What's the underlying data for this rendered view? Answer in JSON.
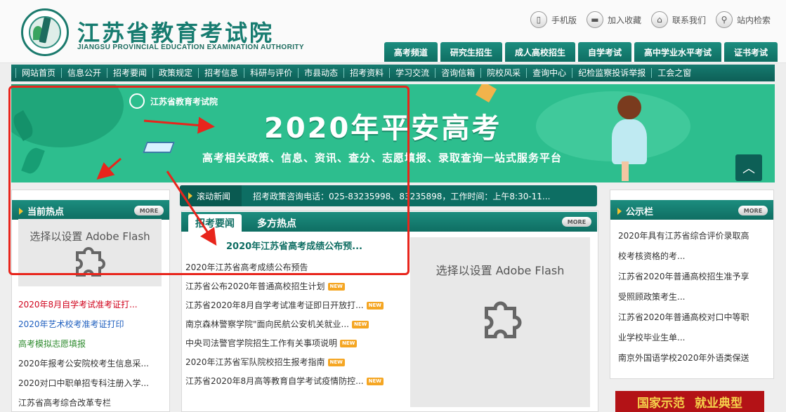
{
  "header": {
    "title": "江苏省教育考试院",
    "subtitle": "JIANGSU PROVINCIAL EDUCATION EXAMINATION AUTHORITY",
    "top_links": [
      {
        "label": "手机版",
        "icon": "phone-icon"
      },
      {
        "label": "加入收藏",
        "icon": "folder-icon"
      },
      {
        "label": "联系我们",
        "icon": "home-icon"
      },
      {
        "label": "站内检索",
        "icon": "search-icon"
      }
    ],
    "tabs": [
      "高考频道",
      "研究生招生",
      "成人高校招生",
      "自学考试",
      "高中学业水平考试",
      "证书考试"
    ]
  },
  "nav": [
    "网站首页",
    "信息公开",
    "招考要闻",
    "政策规定",
    "招考信息",
    "科研与评价",
    "市县动态",
    "招考资料",
    "学习交流",
    "咨询信箱",
    "院校风采",
    "查询中心",
    "纪检监察投诉举报",
    "工会之窗"
  ],
  "banner": {
    "logo_text": "江苏省教育考试院",
    "title": "2020年平安高考",
    "slogan": "高考相关政策、信息、资讯、查分、志愿填报、录取查询一站式服务平台"
  },
  "left_panel": {
    "title": "当前热点",
    "more": "MORE",
    "flash_text": "选择以设置 Adobe Flash",
    "items": [
      {
        "text": "2020年8月自学考试准考证打...",
        "color": "#d0021b"
      },
      {
        "text": "2020年艺术校考准考证打印",
        "color": "#1f5fbf"
      },
      {
        "text": "高考模拟志愿填报",
        "color": "#2e8b2e"
      },
      {
        "text": "2020年报考公安院校考生信息采...",
        "color": "#333333"
      },
      {
        "text": "2020对口中职单招专科注册入学...",
        "color": "#333333"
      },
      {
        "text": "江苏省高考综合改革专栏",
        "color": "#333333"
      }
    ]
  },
  "scroll_news": {
    "label": "滚动新闻",
    "text": "招考政策咨询电话：025-83235998、83235898，工作时间：上午8:30-11..."
  },
  "middle": {
    "tab_active": "招考要闻",
    "tab_other": "多方热点",
    "more": "MORE",
    "headline": "2020年江苏省高考成绩公布预...",
    "items": [
      {
        "text": "2020年江苏省高考成绩公布预告",
        "new": false
      },
      {
        "text": "江苏省公布2020年普通高校招生计划",
        "new": true
      },
      {
        "text": "江苏省2020年8月自学考试准考证即日开放打...",
        "new": true
      },
      {
        "text": "南京森林警察学院\"面向民航公安机关就业...",
        "new": true
      },
      {
        "text": "中央司法警官学院招生工作有关事项说明",
        "new": true
      },
      {
        "text": "2020年江苏省军队院校招生报考指南",
        "new": true
      },
      {
        "text": "江苏省2020年8月高等教育自学考试疫情防控...",
        "new": true
      }
    ],
    "new_label": "NEW",
    "flash_text": "选择以设置 Adobe Flash"
  },
  "right_panel": {
    "title": "公示栏",
    "more": "MORE",
    "items": [
      "2020年具有江苏省综合评价录取高",
      "校考核资格的考...",
      "江苏省2020年普通高校招生准予享",
      "受照顾政策考生...",
      "江苏省2020年普通高校对口中等职",
      "业学校毕业生单...",
      "南京外国语学校2020年外语类保送"
    ],
    "banner_left": "国家示范",
    "banner_right": "就业典型"
  },
  "colors": {
    "brand": "#0f6e63",
    "banner": "#2dbe8e",
    "annotation": "#e8251c"
  }
}
